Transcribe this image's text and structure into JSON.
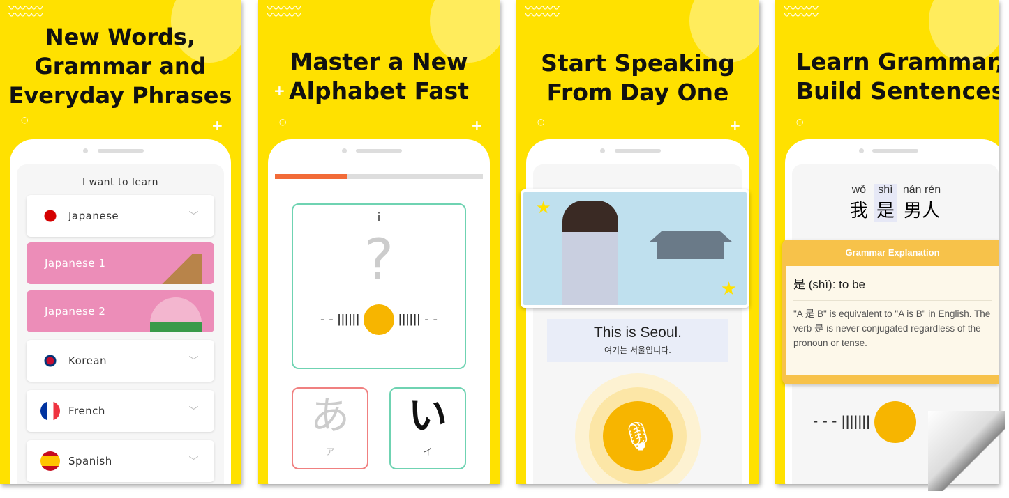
{
  "panels": [
    {
      "title_lines": [
        "New Words,",
        "Grammar and",
        "Everyday Phrases"
      ],
      "prompt": "I want to learn",
      "languages": [
        {
          "label": "Japanese",
          "flag": "japan-flag-icon",
          "type": "language"
        },
        {
          "label": "Japanese 1",
          "type": "course"
        },
        {
          "label": "Japanese 2",
          "type": "course"
        },
        {
          "label": "Korean",
          "flag": "korea-flag-icon",
          "type": "language"
        },
        {
          "label": "French",
          "flag": "france-flag-icon",
          "type": "language"
        },
        {
          "label": "Spanish",
          "flag": "spain-flag-icon",
          "type": "language"
        }
      ]
    },
    {
      "title_lines": [
        "Master a New",
        "Alphabet Fast"
      ],
      "progress_percent": 35,
      "romaji": "i",
      "question_mark": "?",
      "choices": [
        {
          "kana": "あ",
          "katakana": "ア",
          "state": "wrong"
        },
        {
          "kana": "い",
          "katakana": "イ",
          "state": "correct"
        }
      ]
    },
    {
      "title_lines": [
        "Start Speaking",
        "From Day One"
      ],
      "sentence": "This is Seoul.",
      "translation": "여기는 서울입니다."
    },
    {
      "title_lines": [
        "Learn Grammar,",
        "Build Sentences"
      ],
      "words": [
        {
          "pinyin": "wǒ",
          "hanzi": "我"
        },
        {
          "pinyin": "shì",
          "hanzi": "是"
        },
        {
          "pinyin": "nán rén",
          "hanzi": "男人"
        }
      ],
      "popup_title": "Grammar Explanation",
      "definition": "是 (shì): to be",
      "explanation": "\"A 是 B\" is equivalent to \"A is B\" in English. The verb 是 is never conjugated regardless of the pronoun or tense."
    }
  ],
  "colors": {
    "background": "#FFE100",
    "pink": "#EC8DB8",
    "teal": "#6FD3B2",
    "orange": "#F7B500",
    "progress": "#F26B38"
  }
}
